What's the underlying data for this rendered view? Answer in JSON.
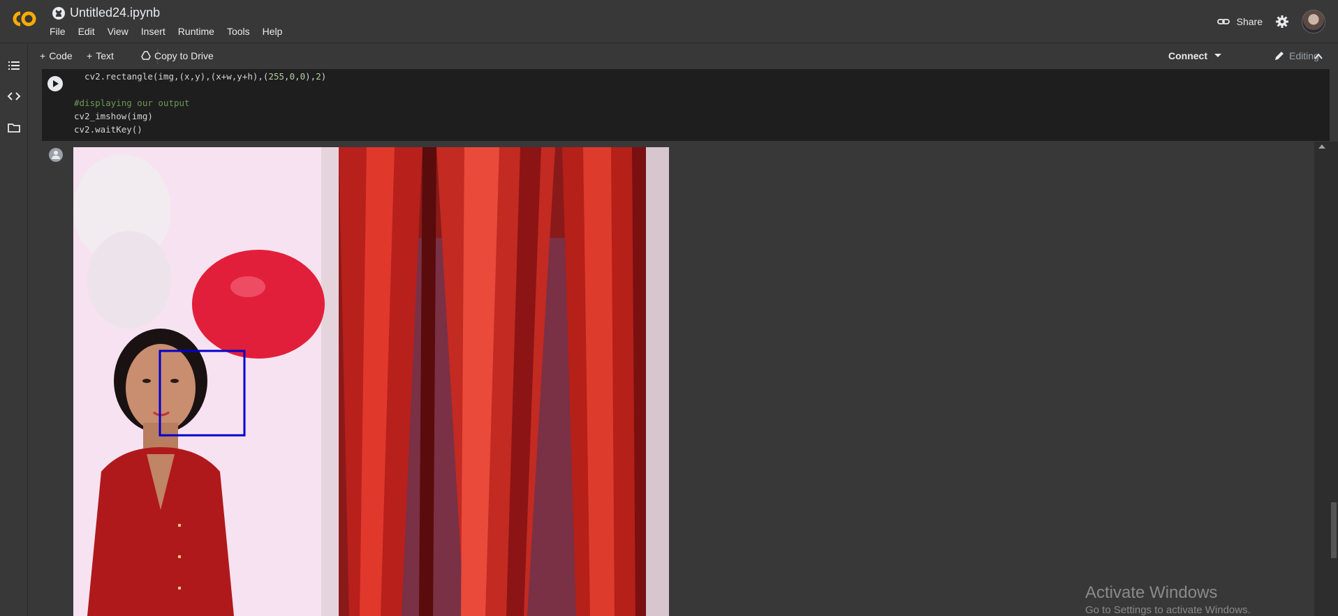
{
  "header": {
    "notebook_title": "Untitled24.ipynb",
    "menu": [
      "File",
      "Edit",
      "View",
      "Insert",
      "Runtime",
      "Tools",
      "Help"
    ],
    "share_label": "Share"
  },
  "toolbar": {
    "add_code_label": "Code",
    "add_text_label": "Text",
    "copy_to_drive_label": "Copy to Drive",
    "connect_label": "Connect",
    "editing_label": "Editing"
  },
  "code_cell": {
    "lines": [
      "  cv2.rectangle(img,(x,y),(x+w,y+h),(255,0,0),2)",
      "",
      "#displaying our output",
      "cv2_imshow(img)",
      "cv2.waitKey()"
    ]
  },
  "colors": {
    "background": "#383838",
    "code_background": "#1e1e1e",
    "logo": "#f9ab00",
    "detection_box": "#0000cc"
  },
  "watermark": {
    "line1": "Activate Windows",
    "line2": "Go to Settings to activate Windows."
  }
}
